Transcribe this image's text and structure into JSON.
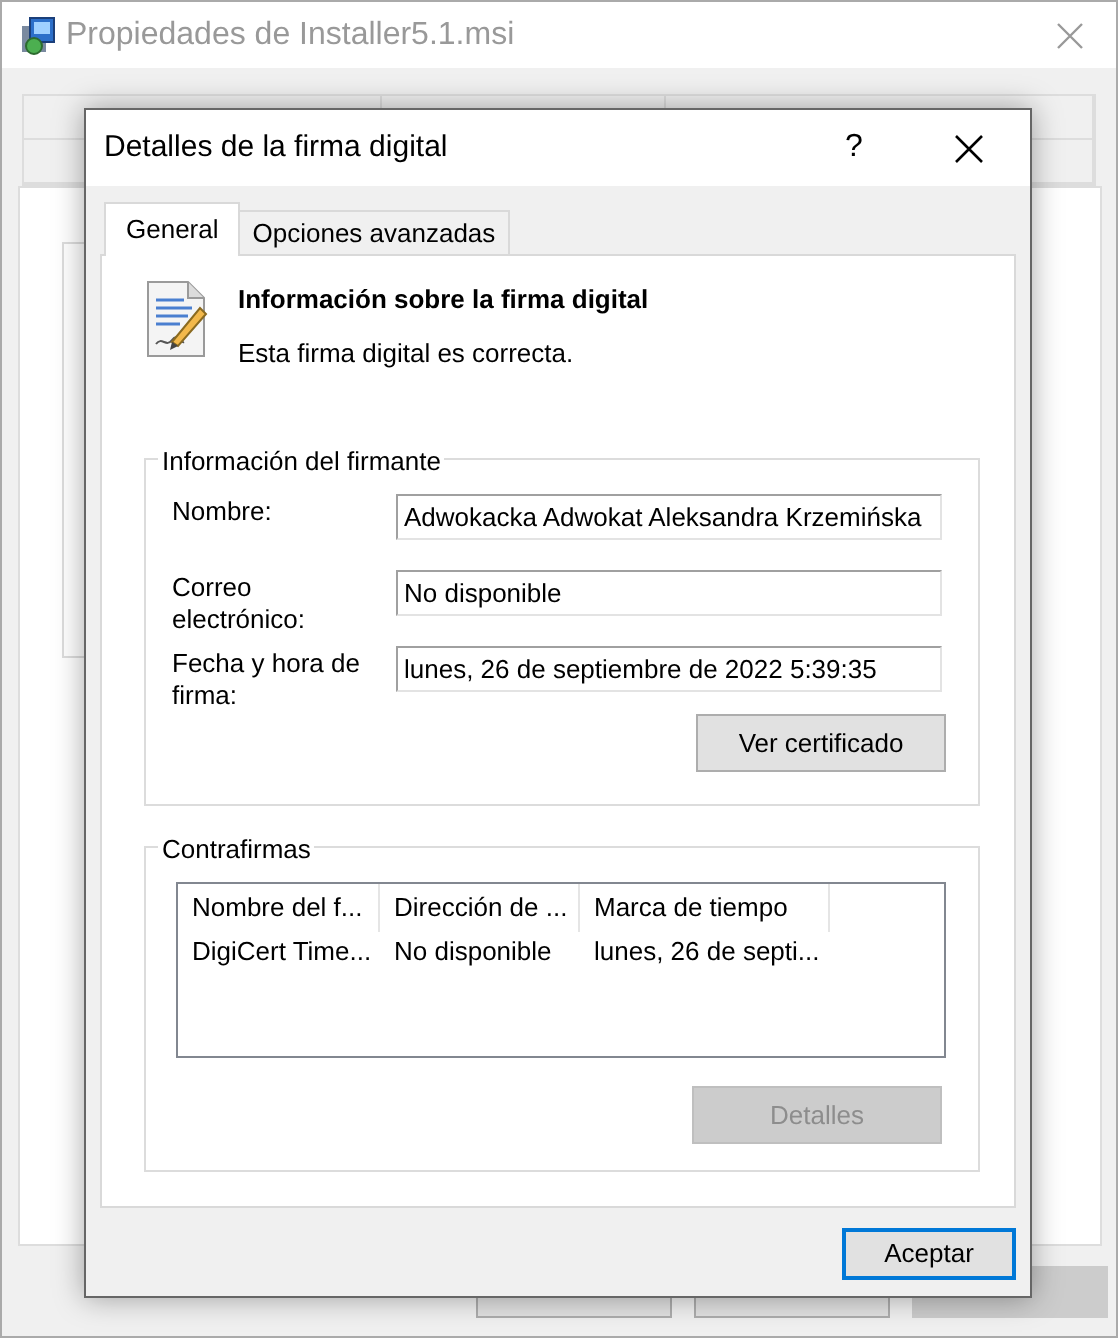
{
  "background_window": {
    "title": "Propiedades de Installer5.1.msi",
    "buttons": [
      {
        "disabled": false
      },
      {
        "disabled": false
      },
      {
        "disabled": true
      }
    ]
  },
  "dialog": {
    "title": "Detalles de la firma digital",
    "help": "?",
    "tabs": [
      {
        "label": "General",
        "selected": true
      },
      {
        "label": "Opciones avanzadas",
        "selected": false
      }
    ],
    "header": {
      "title": "Información sobre la firma digital",
      "message": "Esta firma digital es correcta."
    },
    "signer_group": {
      "title": "Información del firmante",
      "fields": [
        {
          "label": "Nombre:",
          "value": "Adwokacka Adwokat Aleksandra Krzemińska"
        },
        {
          "label": "Correo electrónico:",
          "value": "No disponible"
        },
        {
          "label": "Fecha y hora de firma:",
          "value": "lunes, 26 de septiembre de 2022 5:39:35"
        }
      ],
      "button": {
        "label": "Ver certificado",
        "disabled": false
      }
    },
    "countersignatures": {
      "title": "Contrafirmas",
      "columns": [
        "Nombre del f...",
        "Dirección de ...",
        "Marca de tiempo"
      ],
      "rows": [
        [
          "DigiCert Time...",
          "No disponible",
          "lunes, 26 de septi..."
        ]
      ],
      "button": {
        "label": "Detalles",
        "disabled": true
      }
    },
    "ok_button": {
      "label": "Aceptar",
      "default": true
    }
  }
}
